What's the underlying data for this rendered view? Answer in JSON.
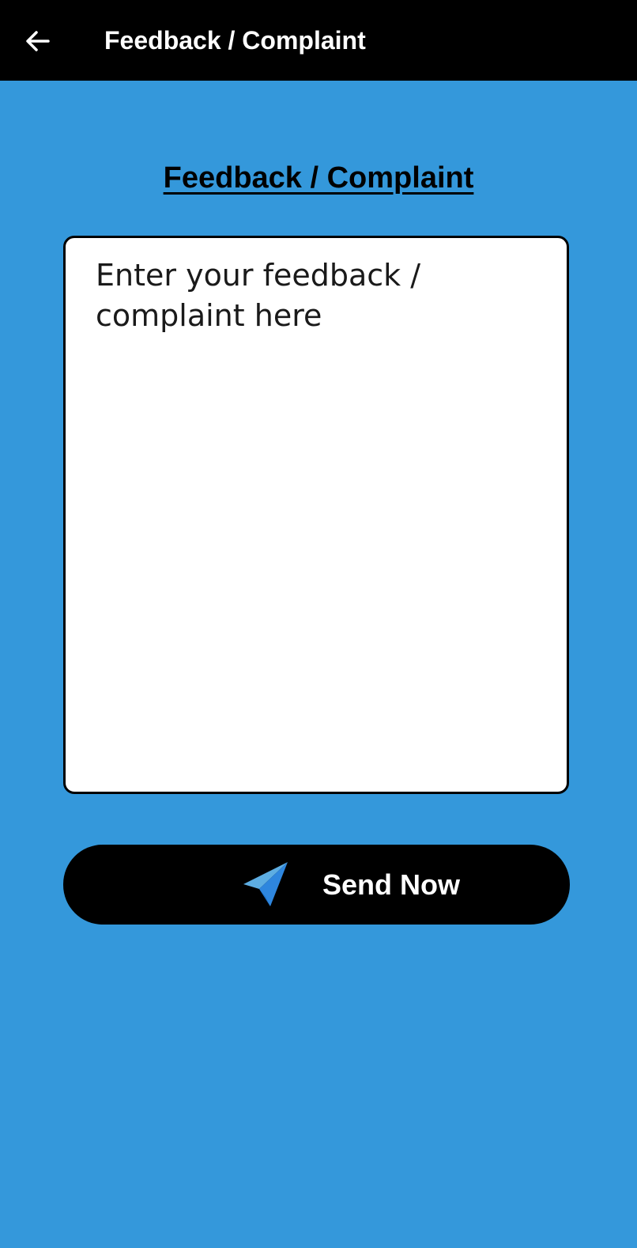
{
  "app_bar": {
    "title": "Feedback / Complaint",
    "back_icon": "arrow-left-icon",
    "background": "#000000"
  },
  "page": {
    "heading": "Feedback / Complaint",
    "background": "#3498db"
  },
  "feedback_field": {
    "placeholder": "Enter your feedback / complaint here",
    "value": ""
  },
  "send_button": {
    "label": "Send Now",
    "icon": "paper-plane-icon",
    "icon_colors": [
      "#5dade2",
      "#2e86de",
      "#1b6fc7"
    ]
  }
}
